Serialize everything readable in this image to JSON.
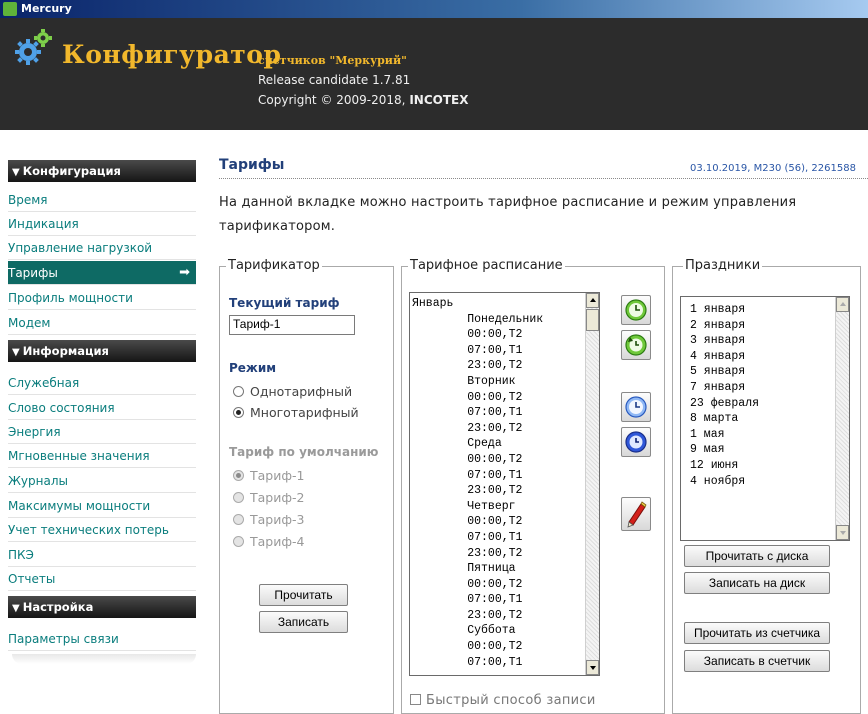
{
  "window": {
    "title": "Mercury"
  },
  "header": {
    "brand": "Конфигуратор",
    "subtitle": "счетчиков \"Меркурий\"",
    "release": "Release candidate 1.7.81",
    "copyright_prefix": "Copyright © 2009-2018,",
    "company": "INCOTEX"
  },
  "sidebar": {
    "sections": [
      {
        "title": "Конфигурация",
        "items": [
          "Время",
          "Индикация",
          "Управление нагрузкой",
          "Тарифы",
          "Профиль мощности",
          "Модем"
        ]
      },
      {
        "title": "Информация",
        "items": [
          "Служебная",
          "Слово состояния",
          "Энергия",
          "Мгновенные значения",
          "Журналы",
          "Максимумы мощности",
          "Учет технических потерь",
          "ПКЭ",
          "Отчеты"
        ]
      },
      {
        "title": "Настройка",
        "items": [
          "Параметры связи"
        ]
      }
    ],
    "active_item": "Тарифы"
  },
  "main": {
    "title": "Тарифы",
    "meta": "03.10.2019, M230 (56), 2261588",
    "description": "На данной вкладке можно настроить тарифное расписание и режим управления тарификатором."
  },
  "tarifikator": {
    "legend": "Тарификатор",
    "current_label": "Текущий тариф",
    "current_value": "Тариф-1",
    "mode_label": "Режим",
    "mode_options": [
      "Однотарифный",
      "Многотарифный"
    ],
    "mode_selected": "Многотарифный",
    "default_label": "Тариф по умолчанию",
    "default_options": [
      "Тариф-1",
      "Тариф-2",
      "Тариф-3",
      "Тариф-4"
    ],
    "default_selected": "Тариф-1",
    "read_btn": "Прочитать",
    "write_btn": "Записать"
  },
  "schedule": {
    "legend": "Тарифное расписание",
    "lines": [
      "Январь",
      "        Понедельник",
      "        00:00,T2",
      "        07:00,T1",
      "        23:00,T2",
      "        Вторник",
      "        00:00,T2",
      "        07:00,T1",
      "        23:00,T2",
      "        Среда",
      "        00:00,T2",
      "        07:00,T1",
      "        23:00,T2",
      "        Четверг",
      "        00:00,T2",
      "        07:00,T1",
      "        23:00,T2",
      "        Пятница",
      "        00:00,T2",
      "        07:00,T1",
      "        23:00,T2",
      "        Суббота",
      "        00:00,T2",
      "        07:00,T1"
    ],
    "fast_write_label": "Быстрый способ записи",
    "fast_write_checked": false
  },
  "icon_buttons": [
    "clock-green-icon",
    "clock-green-refresh-icon",
    "clock-blue-icon",
    "clock-blue-refresh-icon",
    "pen-eraser-icon"
  ],
  "holidays": {
    "legend": "Праздники",
    "items": [
      "1 января",
      "2 января",
      "3 января",
      "4 января",
      "5 января",
      "7 января",
      "23 февраля",
      "8 марта",
      "1 мая",
      "9 мая",
      "12 июня",
      "4 ноября"
    ],
    "read_disk": "Прочитать с диска",
    "write_disk": "Записать на диск",
    "read_meter": "Прочитать из счетчика",
    "write_meter": "Записать в счетчик"
  },
  "colors": {
    "accent_teal": "#0e6a64",
    "brand_gold": "#f2b82c",
    "header_bg": "#2c2c2c",
    "link_teal": "#0a7d7d",
    "title_blue": "#22407a"
  }
}
